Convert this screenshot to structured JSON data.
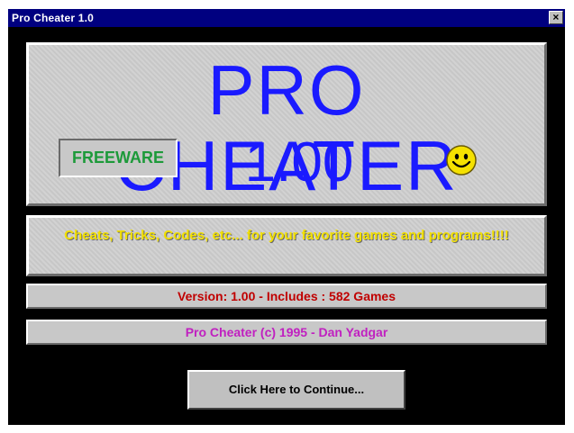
{
  "window": {
    "title": "Pro Cheater 1.0",
    "close_glyph": "×"
  },
  "banner": {
    "title": "PRO CHEATER",
    "badge": "FREEWARE",
    "version": "1.00",
    "mascot_icon": "smiley-face-icon"
  },
  "tagline": "Cheats, Tricks, Codes, etc... for your favorite games and programs!!!!",
  "info": {
    "version_line": "Version: 1.00 - Includes : 582 Games",
    "copyright_line": "Pro Cheater (c) 1995 - Dan Yadgar"
  },
  "actions": {
    "continue_label": "Click Here to Continue..."
  },
  "colors": {
    "title_bar": "#000080",
    "background": "#000000",
    "panel": "#c8c8c8",
    "title_text": "#1a1aff",
    "badge_text": "#1d9a3a",
    "tagline_text": "#f2e000",
    "version_text": "#c00000",
    "copyright_text": "#c020c0",
    "smiley": "#f5e100"
  }
}
